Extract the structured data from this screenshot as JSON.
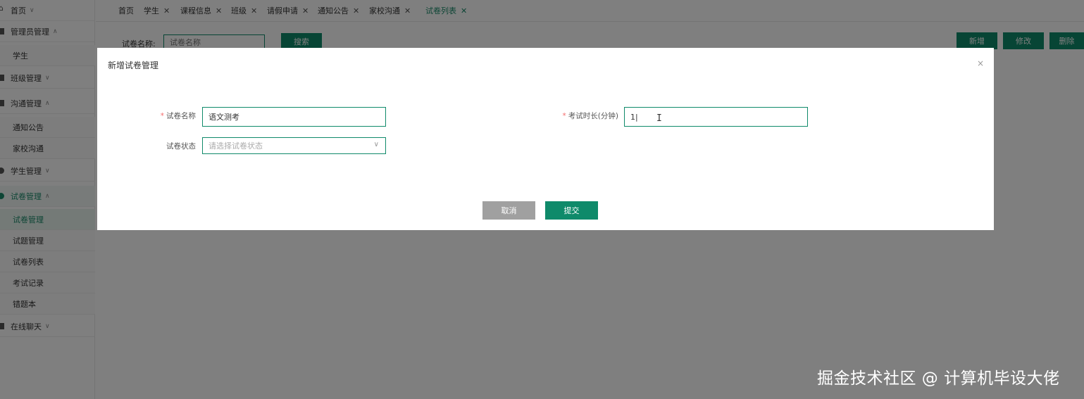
{
  "sidebar": {
    "home": "首页",
    "items": [
      {
        "label": "管理员管理",
        "caret": "^"
      },
      {
        "label": "学生"
      },
      {
        "label": "班级管理",
        "caret": "v"
      },
      {
        "label": "沟通管理",
        "caret": "^"
      },
      {
        "label": "通知公告"
      },
      {
        "label": "家校沟通"
      },
      {
        "label": "学生管理",
        "caret": "v"
      },
      {
        "label": "试卷管理",
        "caret": "^"
      },
      {
        "label": "试卷管理"
      },
      {
        "label": "试题管理"
      },
      {
        "label": "试卷列表"
      },
      {
        "label": "考试记录"
      },
      {
        "label": "错题本"
      },
      {
        "label": "在线聊天",
        "caret": "v"
      }
    ]
  },
  "tabs": [
    {
      "label": "首页"
    },
    {
      "label": "学生"
    },
    {
      "label": "课程信息"
    },
    {
      "label": "班级"
    },
    {
      "label": "请假申请"
    },
    {
      "label": "通知公告"
    },
    {
      "label": "家校沟通"
    },
    {
      "label": "试卷列表"
    }
  ],
  "toolbar": {
    "search_label": "试卷名称:",
    "search_placeholder": "试卷名称",
    "search_button": "搜索",
    "add_button": "新增",
    "edit_button": "修改",
    "delete_button": "删除"
  },
  "modal": {
    "title": "新增试卷管理",
    "close": "×",
    "fields": {
      "paper_name_label": "试卷名称",
      "paper_name_value": "语文测考",
      "duration_label": "考试时长(分钟)",
      "duration_value": "1|",
      "status_label": "试卷状态",
      "status_placeholder": "请选择试卷状态"
    },
    "cancel_button": "取消",
    "submit_button": "提交"
  },
  "watermark": "掘金技术社区 @ 计算机毕设大佬",
  "colors": {
    "accent": "#0f8a6a",
    "cancel": "#a0a0a0",
    "required": "#f56c6c",
    "overlay": "rgba(0,0,0,0.5)"
  }
}
